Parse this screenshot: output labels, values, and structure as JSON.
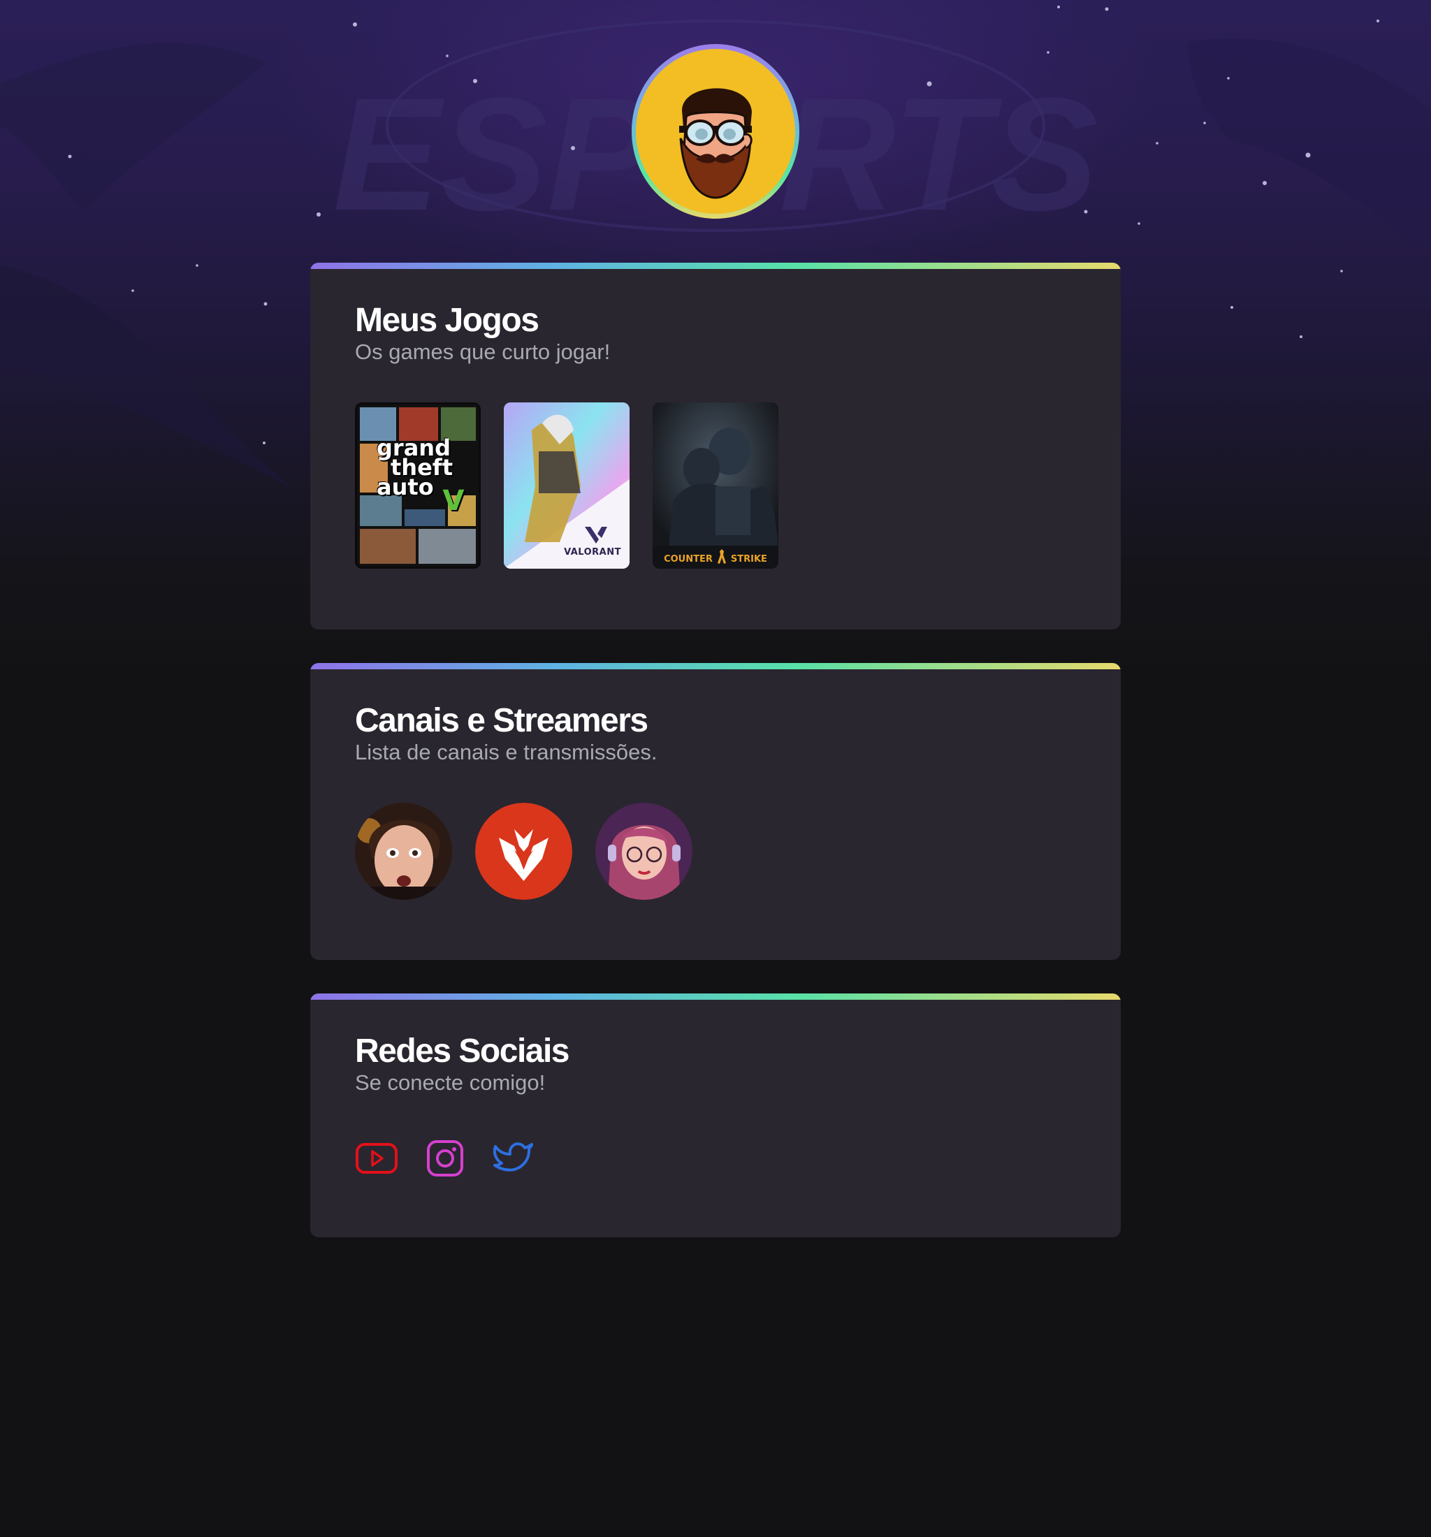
{
  "profile": {
    "avatar_icon": "bearded-gamer-avatar-icon",
    "background_watermark": "ESPORTS"
  },
  "games_section": {
    "title": "Meus Jogos",
    "subtitle": "Os games que curto jogar!",
    "games": [
      {
        "name": "Grand Theft Auto V",
        "cover_lines": [
          "grand",
          "theft",
          "auto"
        ],
        "badge": "V"
      },
      {
        "name": "Valorant",
        "cover_text": "VALORANT"
      },
      {
        "name": "Counter-Strike",
        "cover_text_left": "COUNTER",
        "cover_text_right": "STRIKE"
      }
    ]
  },
  "streamers_section": {
    "title": "Canais e Streamers",
    "subtitle": "Lista de canais e transmissões.",
    "streamers": [
      {
        "icon": "streamer-face-avatar"
      },
      {
        "icon": "red-shield-logo-avatar"
      },
      {
        "icon": "illustrated-girl-avatar"
      }
    ]
  },
  "social_section": {
    "title": "Redes Sociais",
    "subtitle": "Se conecte comigo!",
    "links": [
      {
        "icon": "youtube-icon",
        "color": "#e3101a"
      },
      {
        "icon": "instagram-icon",
        "color": "#d640cf"
      },
      {
        "icon": "twitter-icon",
        "color": "#2d6fe0"
      }
    ]
  },
  "colors": {
    "page_bg": "#121214",
    "card_bg": "#29262f",
    "accent_gradient": [
      "#8f73e8",
      "#5fb2e3",
      "#58e1a7",
      "#e7d96c"
    ],
    "avatar_bg": "#f2be24"
  }
}
